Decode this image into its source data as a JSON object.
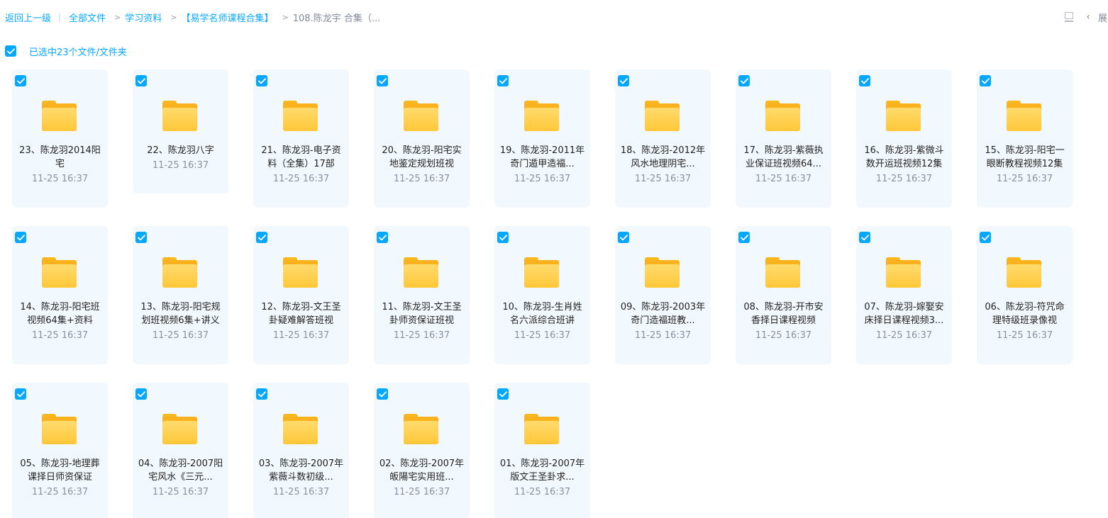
{
  "breadcrumb": {
    "back": "返回上一级",
    "divider": "|",
    "all_files": "全部文件",
    "study": "学习资料",
    "collection": "【易学名师课程合集】",
    "arrow": ">",
    "current": "108.陈龙宇 合集（..."
  },
  "toolbar": {
    "view_icon": "screen-icon",
    "expand_label": "展",
    "expand_icon": "‹"
  },
  "selection": {
    "label": "已选中23个文件/文件夹",
    "checked": true
  },
  "files": [
    {
      "name": "23、陈龙羽2014阳宅",
      "time": "11-25 16:37"
    },
    {
      "name": "22、陈龙羽八字",
      "time": "11-25 16:37"
    },
    {
      "name": "21、陈龙羽-电子资料（全集）17部",
      "time": "11-25 16:37"
    },
    {
      "name": "20、陈龙羽-阳宅实地鉴定规划班视",
      "time": "11-25 16:37"
    },
    {
      "name": "19、陈龙羽-2011年奇门遁甲造福...",
      "time": "11-25 16:37"
    },
    {
      "name": "18、陈龙羽-2012年风水地理阴宅...",
      "time": "11-25 16:37"
    },
    {
      "name": "17、陈龙羽-紫薇执业保证班视频64...",
      "time": "11-25 16:37"
    },
    {
      "name": "16、陈龙羽-紫微斗数开运班视频12集",
      "time": "11-25 16:37"
    },
    {
      "name": "15、陈龙羽-阳宅一眼断教程视频12集",
      "time": "11-25 16:37"
    },
    {
      "name": "14、陈龙羽-阳宅班视频64集+资料",
      "time": "11-25 16:37"
    },
    {
      "name": "13、陈龙羽-阳宅规划班视频6集+讲义",
      "time": "11-25 16:37"
    },
    {
      "name": "12、陈龙羽-文王圣卦疑难解答班视",
      "time": "11-25 16:37"
    },
    {
      "name": "11、陈龙羽-文王圣卦师资保证班视",
      "time": "11-25 16:37"
    },
    {
      "name": "10、陈龙羽-生肖姓名六派综合班讲",
      "time": "11-25 16:37"
    },
    {
      "name": "09、陈龙羽-2003年奇门造福班教...",
      "time": "11-25 16:37"
    },
    {
      "name": "08、陈龙羽-开市安香择日课程视频",
      "time": "11-25 16:37"
    },
    {
      "name": "07、陈龙羽-嫁娶安床择日课程视频3...",
      "time": "11-25 16:37"
    },
    {
      "name": "06、陈龙羽-符咒命理特级班录像视",
      "time": "11-25 16:37"
    },
    {
      "name": "05、陈龙羽-地理葬课择日师资保证",
      "time": "11-25 16:37"
    },
    {
      "name": "04、陈龙羽-2007阳宅风水《三元...",
      "time": "11-25 16:37"
    },
    {
      "name": "03、陈龙羽-2007年紫薇斗数初级...",
      "time": "11-25 16:37"
    },
    {
      "name": "02、陈龙羽-2007年皈陽宅实用班...",
      "time": "11-25 16:37"
    },
    {
      "name": "01、陈龙羽-2007年版文王圣卦求...",
      "time": "11-25 16:37"
    }
  ],
  "colors": {
    "accent": "#06a7ff",
    "card_bg": "#f1f8fe",
    "folder": "#ffc738"
  }
}
